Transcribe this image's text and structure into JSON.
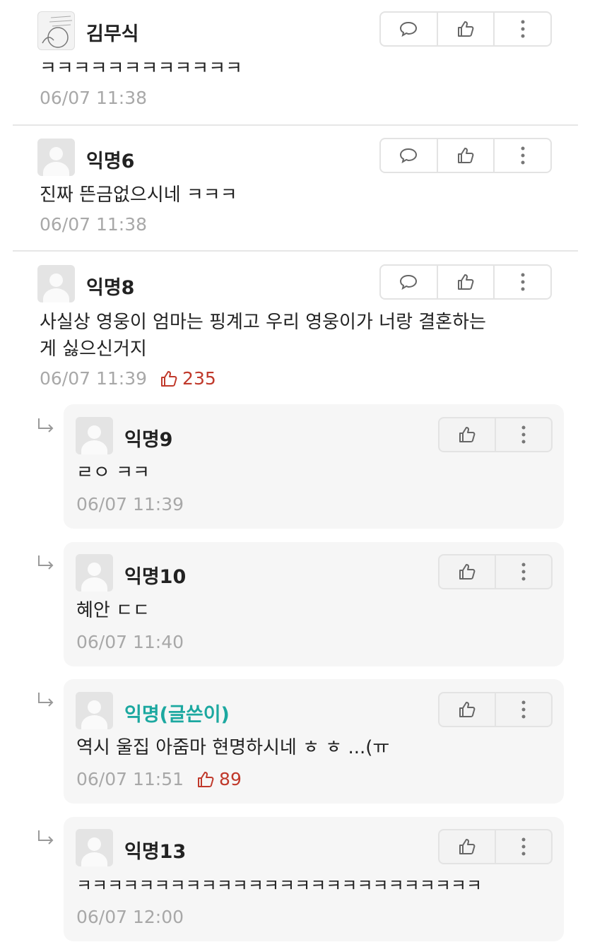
{
  "comments": [
    {
      "name": "김무식",
      "text": "ㅋㅋㅋㅋㅋㅋㅋㅋㅋㅋㅋㅋ",
      "time": "06/07 11:38"
    },
    {
      "name": "익명6",
      "text": "진짜 뜬금없으시네 ㅋㅋㅋ",
      "time": "06/07 11:38"
    },
    {
      "name": "익명8",
      "text_line1": "사실상 영웅이 엄마는 핑계고 우리 영웅이가 너랑 결혼하는",
      "text_line2": "게 싫으신거지",
      "time": "06/07 11:39",
      "likes": "235"
    }
  ],
  "replies": [
    {
      "name": "익명9",
      "text": "ㄹㅇ ㅋㅋ",
      "time": "06/07 11:39"
    },
    {
      "name": "익명10",
      "text": "혜안 ㄷㄷ",
      "time": "06/07 11:40"
    },
    {
      "name": "익명(글쓴이)",
      "text": "역시 울집 아줌마 현명하시네 ㅎ ㅎ ...(ㅠ",
      "time": "06/07 11:51",
      "likes": "89"
    },
    {
      "name": "익명13",
      "text": "ㅋㅋㅋㅋㅋㅋㅋㅋㅋㅋㅋㅋㅋㅋㅋㅋㅋㅋㅋㅋㅋㅋㅋㅋㅋㅋ",
      "time": "06/07 12:00"
    }
  ],
  "colors": {
    "writer": "#1ca8a0",
    "likes": "#c0392b",
    "meta": "#a8a8a8"
  },
  "icons": [
    "comment-icon",
    "thumbs-up-icon",
    "more-vertical-icon",
    "reply-arrow-icon"
  ]
}
